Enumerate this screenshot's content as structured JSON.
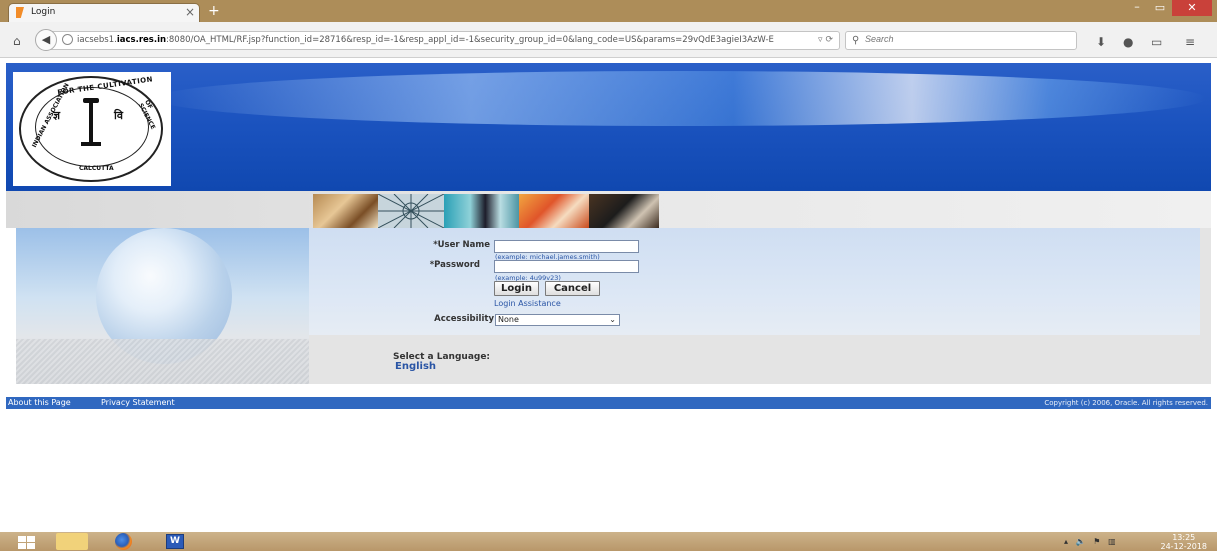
{
  "browser": {
    "tab_title": "Login",
    "tab_close": "×",
    "new_tab": "+",
    "url_prefix": "iacsebs1.",
    "url_domain": "iacs.res.in",
    "url_suffix": ":8080/OA_HTML/RF.jsp?function_id=28716&resp_id=-1&resp_appl_id=-1&security_group_id=0&lang_code=US&params=29vQdE3agieI3AzW-E",
    "search_placeholder": "Search",
    "window_min": "–",
    "window_max": "▭",
    "window_close": "✕"
  },
  "icons": {
    "home": "home-icon",
    "back": "back-arrow-icon",
    "site": "globe-icon",
    "dropdown": "dropdown-arrow-icon",
    "reload": "reload-icon",
    "search": "search-icon",
    "download": "download-icon",
    "pocket": "pocket-icon",
    "sidebar": "sidebar-icon",
    "menu": "hamburger-menu-icon"
  },
  "logo": {
    "top": "FOR THE CULTIVATION",
    "left": "INDIAN ASSOCIATION",
    "right": "OF SCIENCE",
    "bottom": "CALCUTTA"
  },
  "login": {
    "username_label": "*User Name",
    "username_value": "",
    "username_hint": "(example: michael.james.smith)",
    "password_label": "*Password",
    "password_value": "",
    "password_hint": "(example: 4u99v23)",
    "login_button": "Login",
    "cancel_button": "Cancel",
    "assistance_link": "Login Assistance",
    "accessibility_label": "Accessibility",
    "accessibility_value": "None"
  },
  "language": {
    "label": "Select a Language:",
    "english": "English"
  },
  "footer": {
    "about": "About this Page",
    "privacy": "Privacy Statement",
    "copyright": "Copyright (c) 2006, Oracle. All rights reserved."
  },
  "taskbar": {
    "time": "13:25",
    "date": "24-12-2018",
    "word_letter": "W"
  },
  "colors": {
    "banner": "#1a52be",
    "footer": "#3068c0",
    "link": "#2a55a5",
    "taskbar": "#b8976a"
  }
}
